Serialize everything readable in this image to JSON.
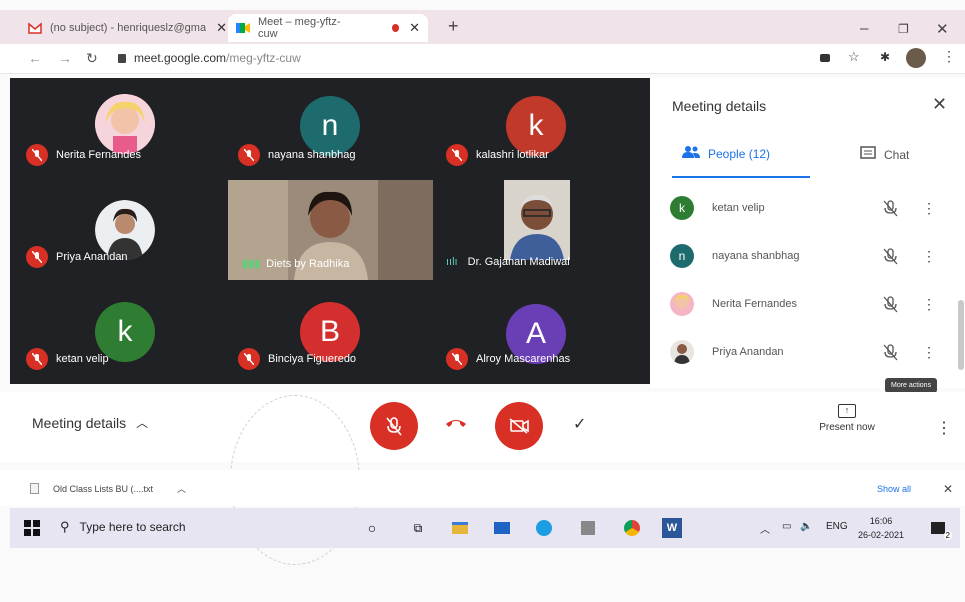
{
  "browser": {
    "tabs": [
      {
        "title": "(no subject) - henriqueslz@gma"
      },
      {
        "title": "Meet – meg-yftz-cuw"
      }
    ],
    "url_host": "meet.google.com",
    "url_path": "/meg-yftz-cuw"
  },
  "participants": [
    {
      "name": "Nerita Fernandes",
      "type": "photo",
      "muted": true
    },
    {
      "name": "nayana shanbhag",
      "type": "letter",
      "letter": "n",
      "color": "#1e6b6e",
      "muted": true
    },
    {
      "name": "kalashri lotlikar",
      "type": "letter",
      "letter": "k",
      "color": "#c0392b",
      "muted": true
    },
    {
      "name": "Priya Anandan",
      "type": "photo",
      "muted": true
    },
    {
      "name": "Diets by Radhika",
      "type": "video",
      "muted": false
    },
    {
      "name": "Dr. Gajanan Madiwal",
      "type": "video",
      "muted": false
    },
    {
      "name": "ketan velip",
      "type": "letter",
      "letter": "k",
      "color": "#2e7d32",
      "muted": true
    },
    {
      "name": "Binciya Figueredo",
      "type": "letter",
      "letter": "B",
      "color": "#d32f2f",
      "muted": true
    },
    {
      "name": "Alroy Mascarenhas",
      "type": "letter",
      "letter": "A",
      "color": "#6a3fb5",
      "muted": true
    }
  ],
  "panel": {
    "title": "Meeting details",
    "tab_people": "People (12)",
    "tab_chat": "Chat",
    "people": [
      {
        "name": "ketan velip",
        "letter": "k",
        "color": "#2e7d32"
      },
      {
        "name": "nayana shanbhag",
        "letter": "n",
        "color": "#1e6b6e"
      },
      {
        "name": "Nerita Fernandes",
        "letter": "",
        "color": "#f4b6c2"
      },
      {
        "name": "Priya Anandan",
        "letter": "",
        "color": "#5a4a42"
      }
    ],
    "tooltip": "More actions"
  },
  "controls": {
    "meeting_details": "Meeting details",
    "present_now": "Present now"
  },
  "download": {
    "file": "Old Class Lists BU (....txt",
    "show_all": "Show all"
  },
  "taskbar": {
    "search": "Type here to search",
    "lang": "ENG",
    "time": "16:06",
    "date": "26-02-2021",
    "notifications": "2"
  }
}
